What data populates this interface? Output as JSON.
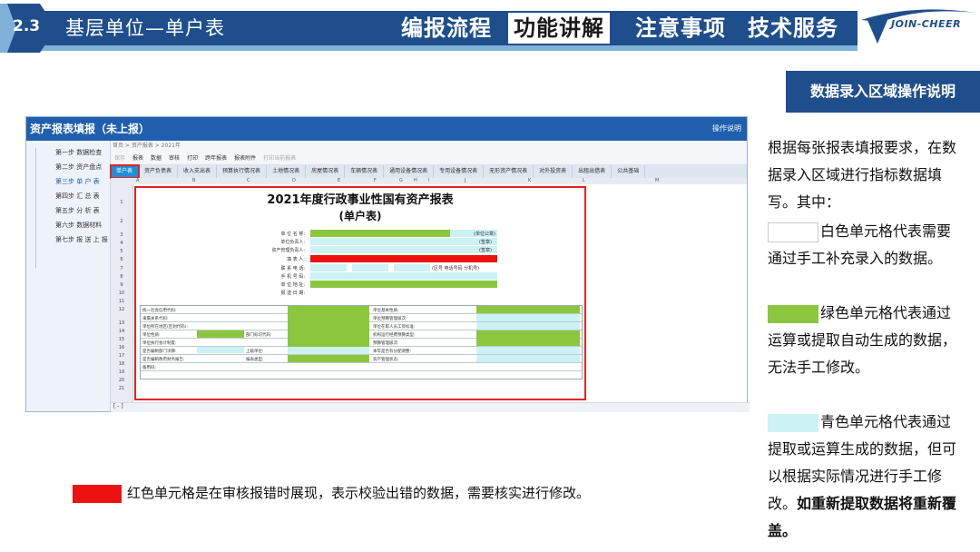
{
  "header": {
    "section_number": "2.3",
    "section_title": "基层单位—单户表",
    "tabs": [
      {
        "label": "编报流程",
        "active": false
      },
      {
        "label": "功能讲解",
        "active": true
      },
      {
        "label": "注意事项",
        "active": false
      },
      {
        "label": "技术服务",
        "active": false
      }
    ],
    "logo_text": "JOIN-CHEER"
  },
  "explain_title": "数据录入区域操作说明",
  "right_panel": {
    "intro": [
      "根据每张报表填报要求，在数",
      "据录入区域进行指标数据填",
      "写。其中："
    ],
    "white": [
      "白色单元格代表需要",
      "通过手工补充录入的数据。"
    ],
    "green": [
      "绿色单元格代表通过",
      "运算或提取自动生成的数据，",
      "无法手工修改。"
    ],
    "cyan": [
      "青色单元格代表通过",
      "提取或运算生成的数据，但可",
      "以根据实际情况进行手工修"
    ],
    "cyan_last_normal": "改。",
    "cyan_last_bold": "如重新提取数据将重新覆",
    "cyan_end_bold": "盖。"
  },
  "app": {
    "title": "资产报表填报（未上报）",
    "help": "操作说明",
    "crumb": "首页 > 资产报表 > 2021年",
    "sidebar": [
      {
        "label": "第一步 数据检查",
        "active": false
      },
      {
        "label": "第二步 资产盘点",
        "active": false
      },
      {
        "label": "第三步 单 户 表",
        "active": true
      },
      {
        "label": "第四步 汇 总 表",
        "active": false
      },
      {
        "label": "第五步 分 析 表",
        "active": false
      },
      {
        "label": "第六步 数据材料",
        "active": false
      },
      {
        "label": "第七步 报 送 上 报",
        "active": false
      }
    ],
    "toolbar": [
      {
        "label": "保存",
        "dim": true
      },
      {
        "label": "报表",
        "dim": false
      },
      {
        "label": "数据",
        "dim": false
      },
      {
        "label": "审核",
        "dim": false
      },
      {
        "label": "打印",
        "dim": false
      },
      {
        "label": "跨年报表",
        "dim": false
      },
      {
        "label": "报表附件",
        "dim": false
      },
      {
        "label": "打印当前报表",
        "dim": true
      }
    ],
    "sheet_tabs": [
      "单户表",
      "资产负债表",
      "收入支出表",
      "预算执行情况表",
      "土地情况表",
      "房屋情况表",
      "车辆情况表",
      "通用设备情况表",
      "专用设备情况表",
      "无形资产情况表",
      "对外投资表",
      "出租出借表",
      "公共基础"
    ],
    "columns": [
      "A",
      "B",
      "C",
      "D",
      "E",
      "F",
      "G",
      "H",
      "I",
      "J",
      "K",
      "L",
      "M"
    ],
    "rows": [
      "1",
      "2",
      "3",
      "4",
      "5",
      "6",
      "7",
      "8",
      "9",
      "10",
      "11",
      "12",
      "13",
      "14",
      "15",
      "16",
      "17",
      "18",
      "19",
      "20",
      "21"
    ],
    "sheet": {
      "title": "2021年度行政事业性国有资产报表",
      "subtitle": "(单户表)",
      "fields": [
        "单 位 名 称:",
        "单位负责人:",
        "资产管理负责人:",
        "填 表 人:",
        "联 系 电 话:",
        "手 机 号 码:",
        "单 位 地 址:",
        "报 送 日 期:"
      ],
      "notes": [
        "(单位公章)",
        "(签章)",
        "(签章)",
        "(区号 电话号码 分机号)"
      ],
      "grid_left": [
        "统一社会信用代码:",
        "隶属关系代码:",
        "单位所在地区(区划代码):",
        "单位性质:",
        "单位执行会计制度:",
        "是否编制部门决算:",
        "是否编制政府财务报告:",
        "备用码:"
      ],
      "grid_mid": [
        "部门标识代码:",
        "上级单位:",
        "报表类型:"
      ],
      "grid_right": [
        "单位基本性质:",
        "单位预算管理级次:",
        "单位在职人员工资标准:",
        "机构运行经费预算类型:",
        "预算管理级次:",
        "本年是否有分配调整:",
        "资产管理状态:"
      ]
    },
    "status": "[ - ]"
  },
  "bottom_note": "红色单元格是在审核报错时展现，表示校验出错的数据，需要核实进行修改。",
  "colors": {
    "brand_blue": "#1f4e8c",
    "green": "#8cc63f",
    "cyan": "#ccf2f5",
    "red": "#ee1111"
  }
}
